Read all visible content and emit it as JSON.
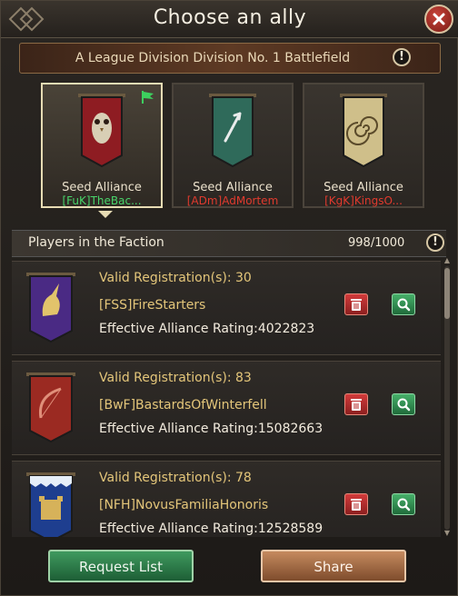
{
  "window": {
    "title": "Choose an ally"
  },
  "subtitle": {
    "text": "A League Division Division No. 1 Battlefield"
  },
  "alliances": [
    {
      "label": "Seed Alliance",
      "name": "[FuK]TheBac...",
      "name_color": "#48d46a",
      "selected": true,
      "banner_color": "#8e1c22",
      "banner_icon": "owl-icon"
    },
    {
      "label": "Seed Alliance",
      "name": "[ADm]AdMortem",
      "name_color": "#e03a2e",
      "selected": false,
      "banner_color": "#2f6a5a",
      "banner_icon": "arrow-emblem-icon"
    },
    {
      "label": "Seed Alliance",
      "name": "[KgK]KingsO...",
      "name_color": "#e03a2e",
      "selected": false,
      "banner_color": "#cfbf8a",
      "banner_icon": "spiral-icon"
    }
  ],
  "faction": {
    "title": "Players in the Faction",
    "count": "998/1000"
  },
  "players": [
    {
      "registrations": "Valid Registration(s): 30",
      "name": "[FSS]FireStarters",
      "rating": "Effective Alliance Rating:4022823",
      "banner_color": "#4a2a84",
      "banner_icon": "unicorn-icon"
    },
    {
      "registrations": "Valid Registration(s): 83",
      "name": "[BwF]BastardsOfWinterfell",
      "rating": "Effective Alliance Rating:15082663",
      "banner_color": "#9b2a22",
      "banner_icon": "bow-icon"
    },
    {
      "registrations": "Valid Registration(s): 78",
      "name": "[NFH]NovusFamiliaHonoris",
      "rating": "Effective Alliance Rating:12528589",
      "banner_color": "#1e3e8f",
      "banner_icon": "castle-icon"
    }
  ],
  "buttons": {
    "request": "Request List",
    "share": "Share"
  }
}
